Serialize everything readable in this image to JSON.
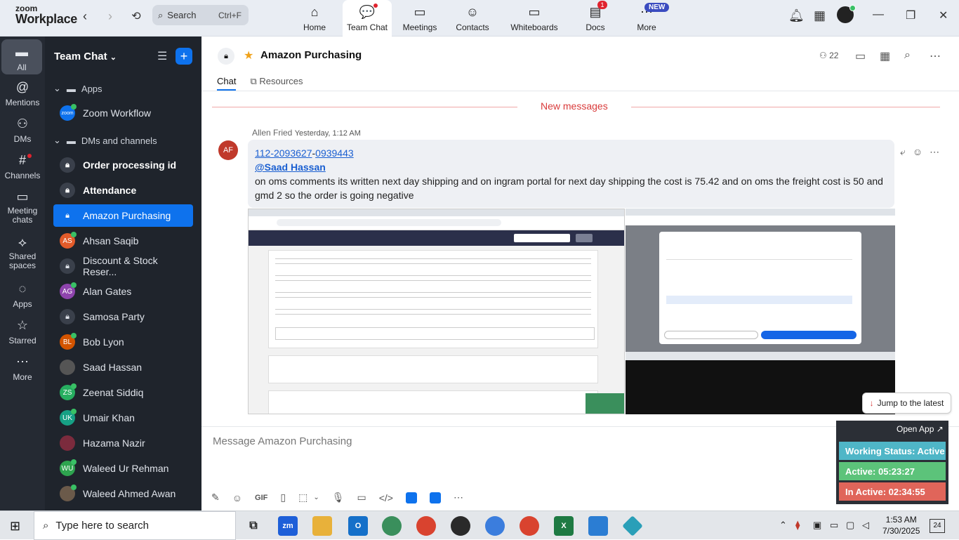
{
  "app": {
    "logo_line1": "zoom",
    "logo_line2": "Workplace"
  },
  "search": {
    "label": "Search",
    "shortcut": "Ctrl+F"
  },
  "top_tabs": [
    {
      "label": "Home",
      "icon": "home-icon"
    },
    {
      "label": "Team Chat",
      "icon": "chat-icon"
    },
    {
      "label": "Meetings",
      "icon": "video-icon"
    },
    {
      "label": "Contacts",
      "icon": "contacts-icon"
    },
    {
      "label": "Whiteboards",
      "icon": "whiteboard-icon"
    },
    {
      "label": "Docs",
      "icon": "docs-icon",
      "badge": "1"
    },
    {
      "label": "More",
      "icon": "more-icon",
      "badge": "NEW"
    }
  ],
  "rail": [
    {
      "label": "All",
      "icon": "chat-bubble-icon"
    },
    {
      "label": "Mentions",
      "icon": "at-icon"
    },
    {
      "label": "DMs",
      "icon": "people-icon"
    },
    {
      "label": "Channels",
      "icon": "hash-icon"
    },
    {
      "label": "Meeting chats",
      "icon": "calendar-icon"
    },
    {
      "label": "Shared spaces",
      "icon": "shared-icon"
    },
    {
      "label": "Apps",
      "icon": "apps-icon"
    },
    {
      "label": "Starred",
      "icon": "star-icon"
    },
    {
      "label": "More",
      "icon": "ellipsis-icon"
    }
  ],
  "sidebar": {
    "title": "Team Chat",
    "section_apps": "Apps",
    "section_dms": "DMs and channels",
    "items": [
      {
        "label": "Zoom Workflow",
        "kind": "app",
        "initials": "zoom",
        "color": "#0e72ed",
        "online": true
      },
      {
        "label": "Order processing id",
        "kind": "lock",
        "bold": true
      },
      {
        "label": "Attendance",
        "kind": "lock",
        "bold": true
      },
      {
        "label": "Amazon Purchasing",
        "kind": "lock",
        "active": true
      },
      {
        "label": "Ahsan Saqib",
        "kind": "person",
        "initials": "AS",
        "color": "#e25b2a",
        "online": true
      },
      {
        "label": "Discount & Stock Reser...",
        "kind": "lock"
      },
      {
        "label": "Alan Gates",
        "kind": "person",
        "initials": "AG",
        "color": "#8e44ad",
        "online": true
      },
      {
        "label": "Samosa Party",
        "kind": "lock"
      },
      {
        "label": "Bob Lyon",
        "kind": "person",
        "initials": "BL",
        "color": "#d35400",
        "online": true
      },
      {
        "label": "Saad Hassan",
        "kind": "person",
        "initials": "",
        "color": "#555555",
        "online": false
      },
      {
        "label": "Zeenat Siddiq",
        "kind": "person",
        "initials": "ZS",
        "color": "#27ae60",
        "online": true
      },
      {
        "label": "Umair Khan",
        "kind": "person",
        "initials": "UK",
        "color": "#16a085",
        "online": true
      },
      {
        "label": "Hazama Nazir",
        "kind": "person",
        "initials": "",
        "color": "#7b2b3d",
        "online": false
      },
      {
        "label": "Waleed Ur Rehman",
        "kind": "person",
        "initials": "WU",
        "color": "#2ea44f",
        "online": true
      },
      {
        "label": "Waleed Ahmed Awan",
        "kind": "person",
        "initials": "",
        "color": "#6b5a4a",
        "online": true
      }
    ]
  },
  "channel": {
    "title": "Amazon Purchasing",
    "members": "22",
    "tabs": [
      "Chat",
      "Resources"
    ],
    "new_messages": "New messages"
  },
  "message": {
    "initials": "AF",
    "author": "Allen Fried",
    "time": "Yesterday, 1:12 AM",
    "link_a": "112-2093627",
    "link_sep": "-",
    "link_b": "0939443",
    "mention": "@Saad Hassan",
    "body": "on oms comments its written next day shipping and on ingram portal for next day shipping the cost is 75.42 and on oms the freight cost is 50 and gmd 2 so the order is going negative"
  },
  "jump_latest": "Jump to the latest",
  "composer": {
    "placeholder": "Message Amazon Purchasing",
    "gif": "GIF"
  },
  "work_status": {
    "open_app": "Open App ↗",
    "status": "Working Status: Active",
    "active": "Active: 05:23:27",
    "inactive": "In Active: 02:34:55",
    "colors": {
      "status": "#4fb6c7",
      "active": "#5cc37a",
      "inactive": "#e0655a"
    }
  },
  "taskbar": {
    "search_placeholder": "Type here to search",
    "time": "1:53 AM",
    "date": "7/30/2025",
    "notifications": "24"
  }
}
